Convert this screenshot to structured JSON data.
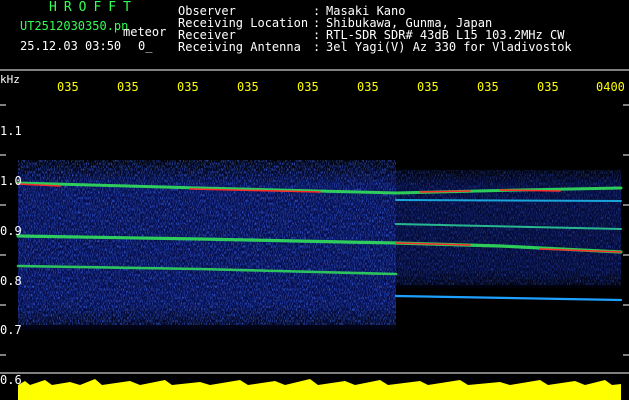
{
  "app": {
    "brand": "HROFFT",
    "filename": "UT2512030350.pn",
    "overlay_label": "meteor",
    "datetime": "25.12.03 03:50",
    "count": "0_"
  },
  "station": [
    {
      "label": "Observer",
      "value": "Masaki Kano"
    },
    {
      "label": "Receiving Location",
      "value": "Shibukawa, Gunma, Japan"
    },
    {
      "label": "Receiver",
      "value": "RTL-SDR SDR# 43dB L15 103.2MHz CW"
    },
    {
      "label": "Receiving Antenna",
      "value": "3el Yagi(V) Az 330 for Vladivostok"
    }
  ],
  "axis": {
    "y_unit": "kHz",
    "time_ticks": [
      "035",
      "035",
      "035",
      "035",
      "035",
      "035",
      "035",
      "035",
      "035",
      "0400"
    ],
    "freq_ticks": [
      "1.1",
      "1.0",
      "0.9",
      "0.8",
      "0.7",
      "0.6"
    ]
  },
  "colors": {
    "background": "#000000",
    "header_text": "#ffffff",
    "brand_text": "#33ff55",
    "time_tick": "#ffff00",
    "noise_blue": "#1a3cff",
    "signal_red": "#ff2020",
    "amplitude_yellow": "#ffff00"
  }
}
